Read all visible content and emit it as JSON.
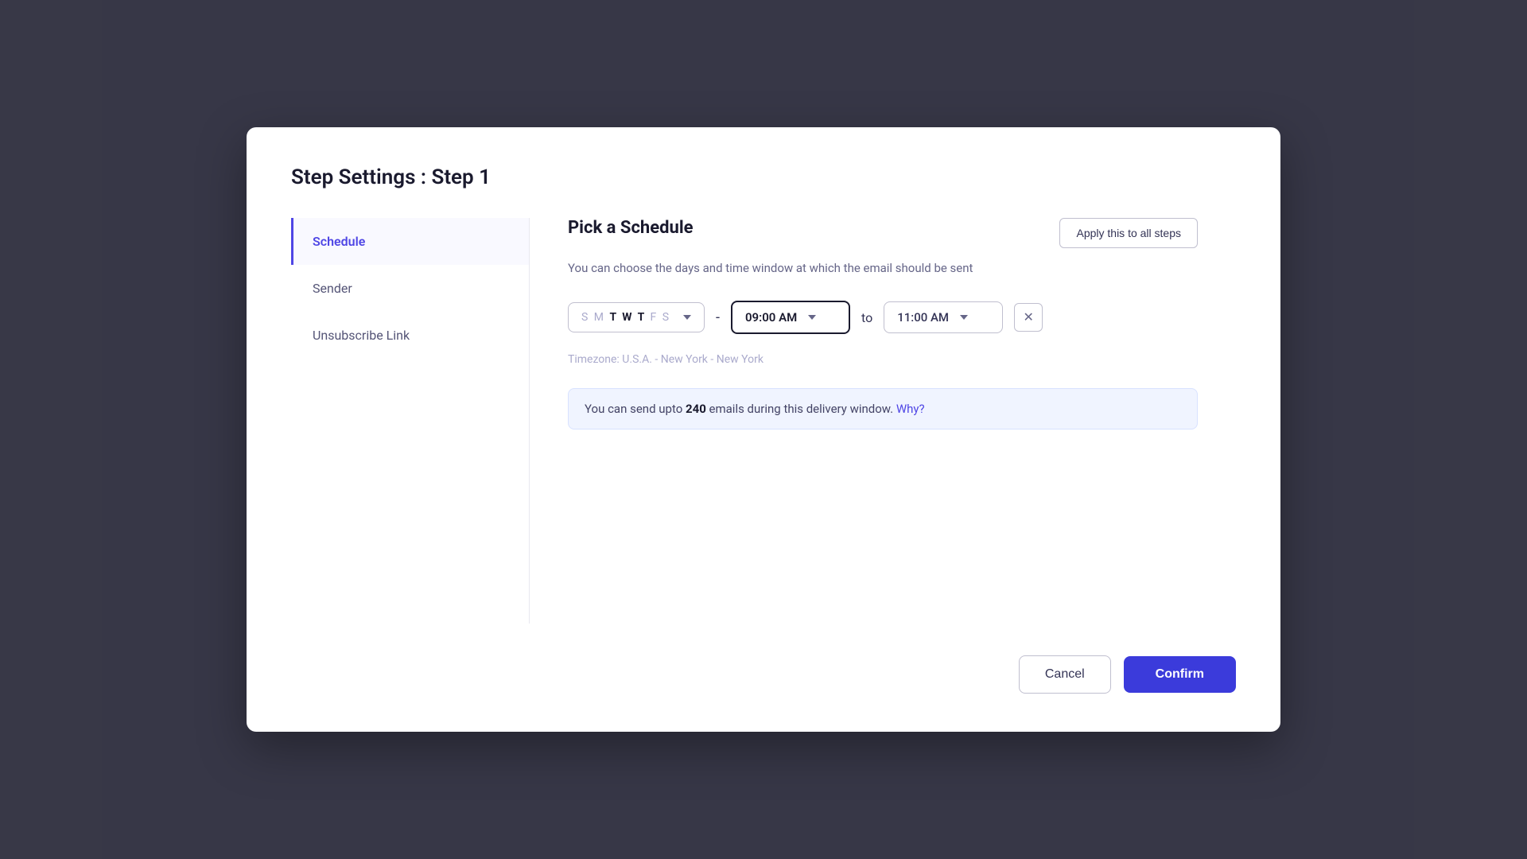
{
  "modal": {
    "title": "Step Settings : Step 1",
    "sidebar": {
      "items": [
        {
          "id": "schedule",
          "label": "Schedule",
          "active": true
        },
        {
          "id": "sender",
          "label": "Sender",
          "active": false
        },
        {
          "id": "unsubscribe-link",
          "label": "Unsubscribe Link",
          "active": false
        }
      ]
    },
    "content": {
      "section_title": "Pick a Schedule",
      "apply_all_label": "Apply this to all steps",
      "description": "You can choose the days and time window at which the email should be sent",
      "days": {
        "display": "S M T W T F S",
        "active_days": [
          "T",
          "W",
          "T"
        ],
        "inactive_days": [
          "S",
          "M",
          "F",
          "S"
        ]
      },
      "separator": "-",
      "start_time": "09:00 AM",
      "to_label": "to",
      "end_time": "11:00 AM",
      "timezone": "Timezone: U.S.A. - New York - New York",
      "info_message_prefix": "You can send upto ",
      "info_count": "240",
      "info_message_suffix": " emails during this delivery window.",
      "why_label": "Why?"
    },
    "footer": {
      "cancel_label": "Cancel",
      "confirm_label": "Confirm"
    }
  }
}
